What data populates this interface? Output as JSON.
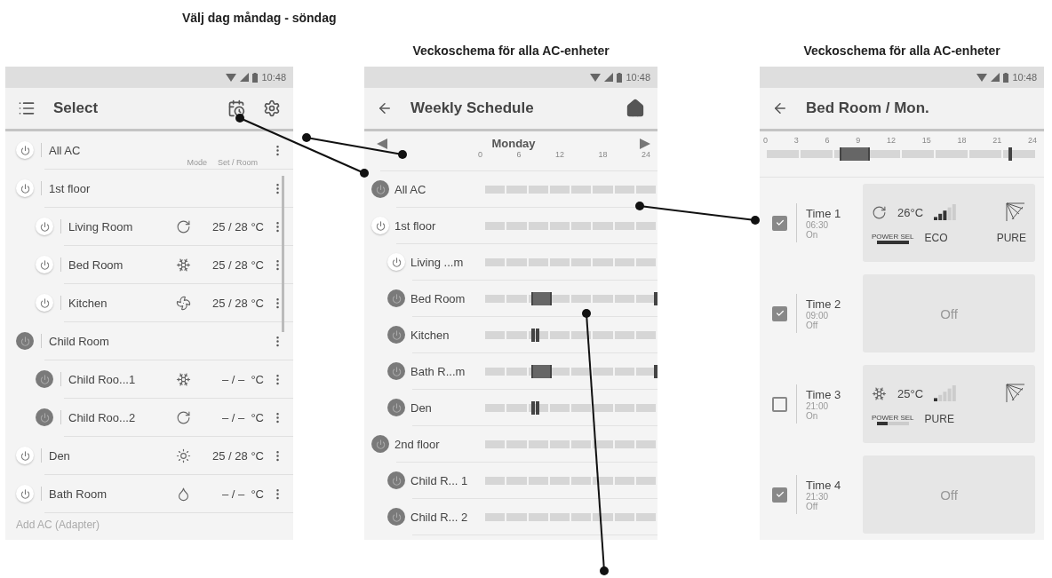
{
  "captions": {
    "day_select": "Välj dag måndag - söndag",
    "schedule_titles": [
      "Veckoschema för alla AC-enheter",
      "Veckoschema för alla AC-enheter"
    ]
  },
  "select_screen": {
    "status_time": "10:48",
    "title": "Select",
    "column_headers": [
      "Mode",
      "Set / Room"
    ],
    "units": [
      {
        "name": "All AC",
        "on": true
      },
      {
        "name": "1st floor",
        "on": true,
        "children": [
          {
            "name": "Living Room",
            "on": true,
            "mode": {
              "kind": "auto"
            },
            "temperature": "25 / 28 °C"
          },
          {
            "name": "Bed Room",
            "on": true,
            "mode": {
              "kind": "cool"
            },
            "temperature": "25 / 28 °C"
          },
          {
            "name": "Kitchen",
            "on": true,
            "mode": {
              "kind": "fan"
            },
            "temperature": "25 / 28 °C"
          }
        ]
      },
      {
        "name": "Child Room",
        "on": false,
        "children": [
          {
            "name": "Child Roo...1",
            "on": false,
            "mode": {
              "kind": "cool"
            },
            "temperature": "– / –  °C"
          },
          {
            "name": "Child Roo...2",
            "on": false,
            "mode": {
              "kind": "auto"
            },
            "temperature": "– / –  °C"
          }
        ]
      },
      {
        "name": "Den",
        "on": true,
        "mode": {
          "kind": "heat"
        },
        "temperature": "25 / 28 °C"
      },
      {
        "name": "Bath Room",
        "on": true,
        "mode": {
          "kind": "dry"
        },
        "temperature": "– / –  °C"
      }
    ],
    "add_link": "Add AC (Adapter)"
  },
  "schedule_screen": {
    "status_time": "10:48",
    "title": "Weekly Schedule",
    "day": "Monday",
    "ticks": [
      "0",
      "6",
      "12",
      "18",
      "24"
    ],
    "rows": [
      {
        "name": "All AC",
        "on": false
      },
      {
        "name": "1st floor",
        "on": true,
        "children": [
          {
            "name": "Living ...m",
            "on": true
          },
          {
            "name": "Bed Room",
            "on": false,
            "spans": [
              {
                "start": {
                  "level": 0.27
                },
                "end": {
                  "level": 0.375
                }
              },
              {
                "start": {
                  "level": 0.98
                },
                "end": {
                  "level": 0.98
                }
              }
            ]
          },
          {
            "name": "Kitchen",
            "on": false,
            "spans": [
              {
                "start": {
                  "level": 0.27
                },
                "end": {
                  "level": 0.28
                }
              },
              {
                "start": {
                  "level": 0.295
                },
                "end": {
                  "level": 0.295
                }
              }
            ]
          },
          {
            "name": "Bath R...m",
            "on": false,
            "spans": [
              {
                "start": {
                  "level": 0.27
                },
                "end": {
                  "level": 0.375
                }
              },
              {
                "start": {
                  "level": 0.98
                },
                "end": {
                  "level": 0.98
                }
              }
            ]
          },
          {
            "name": "Den",
            "on": false,
            "spans": [
              {
                "start": {
                  "level": 0.27
                },
                "end": {
                  "level": 0.28
                }
              },
              {
                "start": {
                  "level": 0.295
                },
                "end": {
                  "level": 0.295
                }
              }
            ]
          }
        ]
      },
      {
        "name": "2nd floor",
        "on": false,
        "children": [
          {
            "name": "Child R... 1",
            "on": false
          },
          {
            "name": "Child R... 2",
            "on": false
          }
        ]
      }
    ]
  },
  "detail_screen": {
    "status_time": "10:48",
    "title": "Bed Room / Mon.",
    "ticks": [
      "0",
      "3",
      "6",
      "9",
      "12",
      "15",
      "18",
      "21",
      "24"
    ],
    "spans": [
      {
        "start": {
          "level": 0.27
        },
        "end": {
          "level": 0.375
        }
      },
      {
        "start": {
          "level": 0.895
        },
        "end": {
          "level": 0.895
        }
      }
    ],
    "timers": [
      {
        "label": "Time 1",
        "time": "06:30",
        "action": "On",
        "checked": true,
        "kind": "on",
        "mode": {
          "kind": "auto"
        },
        "temperature": "26°C",
        "fan": {
          "level": 0.6
        },
        "power_sel": {
          "label": "POWER SEL",
          "level": 1
        },
        "tags": [
          "ECO",
          "PURE"
        ]
      },
      {
        "label": "Time 2",
        "time": "09:00",
        "action": "Off",
        "checked": true,
        "kind": "off",
        "off_label": "Off"
      },
      {
        "label": "Time 3",
        "time": "21:00",
        "action": "On",
        "checked": false,
        "kind": "on",
        "mode": {
          "kind": "cool"
        },
        "temperature": "25°C",
        "fan": {
          "level": 0.2
        },
        "power_sel": {
          "label": "POWER SEL",
          "level": 0.34
        },
        "tags": [
          "PURE"
        ]
      },
      {
        "label": "Time 4",
        "time": "21:30",
        "action": "Off",
        "checked": true,
        "kind": "off",
        "off_label": "Off"
      }
    ]
  }
}
